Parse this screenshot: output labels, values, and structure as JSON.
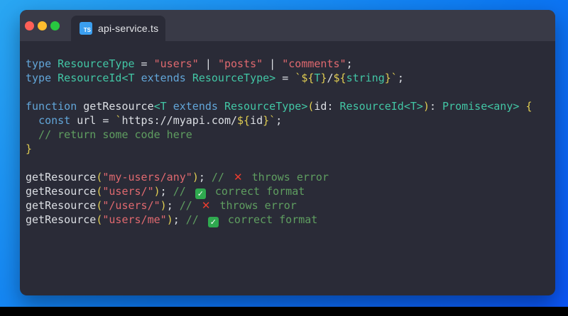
{
  "window": {
    "title_bar": {
      "traffic_lights": [
        {
          "name": "close"
        },
        {
          "name": "minimize"
        },
        {
          "name": "zoom"
        }
      ],
      "tab": {
        "label": "api-service.ts",
        "icon_text": "TS"
      }
    },
    "editor": {
      "language": "typescript",
      "code_lines": [
        [
          {
            "c": "kw",
            "t": "type"
          },
          {
            "c": "pl",
            "t": " "
          },
          {
            "c": "type",
            "t": "ResourceType"
          },
          {
            "c": "pl",
            "t": " = "
          },
          {
            "c": "str",
            "t": "\"users\""
          },
          {
            "c": "pl",
            "t": " | "
          },
          {
            "c": "str",
            "t": "\"posts\""
          },
          {
            "c": "pl",
            "t": " | "
          },
          {
            "c": "str",
            "t": "\"comments\""
          },
          {
            "c": "pl",
            "t": ";"
          }
        ],
        [
          {
            "c": "kw",
            "t": "type"
          },
          {
            "c": "pl",
            "t": " "
          },
          {
            "c": "type",
            "t": "ResourceId<T"
          },
          {
            "c": "pl",
            "t": " "
          },
          {
            "c": "kw",
            "t": "extends"
          },
          {
            "c": "pl",
            "t": " "
          },
          {
            "c": "type",
            "t": "ResourceType>"
          },
          {
            "c": "pl",
            "t": " = "
          },
          {
            "c": "tpl",
            "t": "`${"
          },
          {
            "c": "type",
            "t": "T"
          },
          {
            "c": "tpl",
            "t": "}"
          },
          {
            "c": "pl",
            "t": "/"
          },
          {
            "c": "tpl",
            "t": "${"
          },
          {
            "c": "type",
            "t": "string"
          },
          {
            "c": "tpl",
            "t": "}`"
          },
          {
            "c": "pl",
            "t": ";"
          }
        ],
        [],
        [
          {
            "c": "kw",
            "t": "function"
          },
          {
            "c": "pl",
            "t": " getResource"
          },
          {
            "c": "type",
            "t": "<T"
          },
          {
            "c": "pl",
            "t": " "
          },
          {
            "c": "kw",
            "t": "extends"
          },
          {
            "c": "pl",
            "t": " "
          },
          {
            "c": "type",
            "t": "ResourceType>"
          },
          {
            "c": "brk",
            "t": "("
          },
          {
            "c": "pl",
            "t": "id: "
          },
          {
            "c": "type",
            "t": "ResourceId<T>"
          },
          {
            "c": "brk",
            "t": ")"
          },
          {
            "c": "pl",
            "t": ": "
          },
          {
            "c": "type",
            "t": "Promise<any>"
          },
          {
            "c": "pl",
            "t": " "
          },
          {
            "c": "brk",
            "t": "{"
          }
        ],
        [
          {
            "c": "pl",
            "t": "  "
          },
          {
            "c": "kw",
            "t": "const"
          },
          {
            "c": "pl",
            "t": " url = "
          },
          {
            "c": "tpl",
            "t": "`"
          },
          {
            "c": "pl",
            "t": "https://myapi.com/"
          },
          {
            "c": "tpl",
            "t": "${"
          },
          {
            "c": "pl",
            "t": "id"
          },
          {
            "c": "tpl",
            "t": "}`"
          },
          {
            "c": "pl",
            "t": ";"
          }
        ],
        [
          {
            "c": "cmt",
            "t": "  // return some code here"
          }
        ],
        [
          {
            "c": "brk",
            "t": "}"
          }
        ],
        [],
        [
          {
            "c": "pl",
            "t": "getResource"
          },
          {
            "c": "brk",
            "t": "("
          },
          {
            "c": "str",
            "t": "\"my-users/any\""
          },
          {
            "c": "brk",
            "t": ")"
          },
          {
            "c": "pl",
            "t": "; "
          },
          {
            "c": "cmt",
            "t": "// "
          },
          {
            "icon": "cross",
            "t": "✕"
          },
          {
            "c": "cmt",
            "t": " throws error"
          }
        ],
        [
          {
            "c": "pl",
            "t": "getResource"
          },
          {
            "c": "brk",
            "t": "("
          },
          {
            "c": "str",
            "t": "\"users/\""
          },
          {
            "c": "brk",
            "t": ")"
          },
          {
            "c": "pl",
            "t": "; "
          },
          {
            "c": "cmt",
            "t": "// "
          },
          {
            "icon": "check",
            "t": "✓"
          },
          {
            "c": "cmt",
            "t": " correct format"
          }
        ],
        [
          {
            "c": "pl",
            "t": "getResource"
          },
          {
            "c": "brk",
            "t": "("
          },
          {
            "c": "str",
            "t": "\"/users/\""
          },
          {
            "c": "brk",
            "t": ")"
          },
          {
            "c": "pl",
            "t": "; "
          },
          {
            "c": "cmt",
            "t": "// "
          },
          {
            "icon": "cross",
            "t": "✕"
          },
          {
            "c": "cmt",
            "t": " throws error"
          }
        ],
        [
          {
            "c": "pl",
            "t": "getResource"
          },
          {
            "c": "brk",
            "t": "("
          },
          {
            "c": "str",
            "t": "\"users/me\""
          },
          {
            "c": "brk",
            "t": ")"
          },
          {
            "c": "pl",
            "t": "; "
          },
          {
            "c": "cmt",
            "t": "// "
          },
          {
            "icon": "check",
            "t": "✓"
          },
          {
            "c": "cmt",
            "t": " correct format"
          }
        ]
      ]
    }
  },
  "colors": {
    "grad_top_left": "#2aa7f2",
    "grad_mid": "#0c78f2",
    "grad_bottom_right": "#0b55f6",
    "editor_bg": "#2a2b37",
    "titlebar_bg": "#393a47",
    "tab_text": "#e4e5e9",
    "ts_blue": "#3b9ff0",
    "tl_red": "#ff5f57",
    "tl_yellow": "#febc2e",
    "tl_green": "#28c840",
    "keyword": "#62a6d9",
    "type": "#42c6a5",
    "string": "#e0696f",
    "template": "#e0cd52",
    "plain": "#dcdfe4",
    "comment": "#5f9e60",
    "cross_red": "#ea3d2f",
    "check_green": "#2fa94f"
  }
}
